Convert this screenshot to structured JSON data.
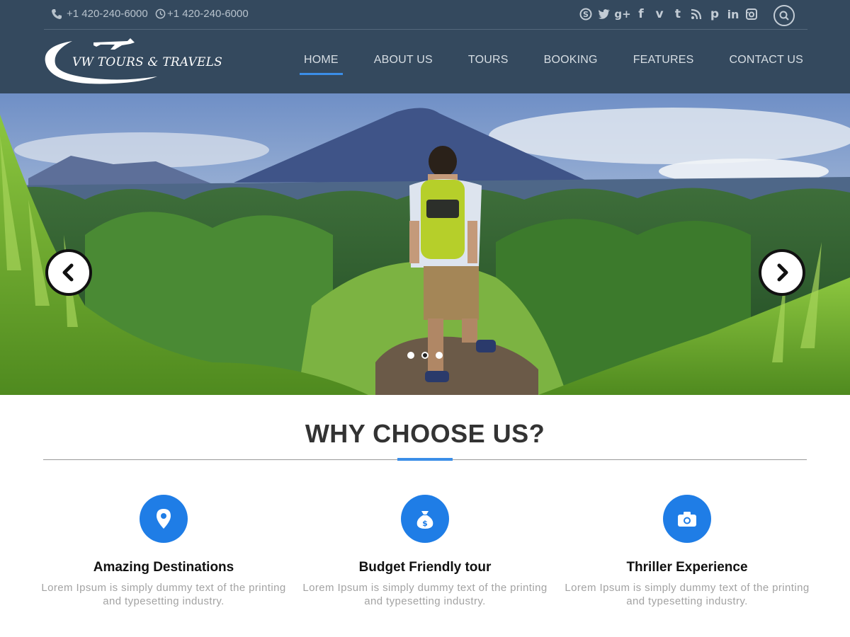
{
  "topbar": {
    "phone": "+1 420-240-6000",
    "hours": "+1 420-240-6000",
    "social": [
      "skype",
      "twitter",
      "google-plus",
      "facebook",
      "vimeo",
      "tumblr",
      "rss",
      "pinterest",
      "linkedin",
      "instagram"
    ]
  },
  "brand": {
    "logo_text": "VW TOURS & TRAVELS"
  },
  "nav": {
    "items": [
      {
        "label": "HOME"
      },
      {
        "label": "ABOUT US"
      },
      {
        "label": "TOURS"
      },
      {
        "label": "BOOKING"
      },
      {
        "label": "FEATURES"
      },
      {
        "label": "CONTACT US"
      }
    ]
  },
  "slider": {
    "slide_count": 3,
    "active_slide": 2
  },
  "why": {
    "title": "WHY CHOOSE US?",
    "features": [
      {
        "title": "Amazing Destinations",
        "text": "Lorem Ipsum is simply dummy text of the printing and typesetting industry.",
        "icon": "map-pin-icon"
      },
      {
        "title": "Budget Friendly tour",
        "text": "Lorem Ipsum is simply dummy text of the printing and typesetting industry.",
        "icon": "money-bag-icon"
      },
      {
        "title": "Thriller Experience",
        "text": "Lorem Ipsum is simply dummy text of the printing and typesetting industry.",
        "icon": "camera-icon"
      }
    ]
  },
  "colors": {
    "header_bg": "#34495e",
    "accent": "#3b8ee8",
    "icon_bg": "#1f7de6"
  }
}
